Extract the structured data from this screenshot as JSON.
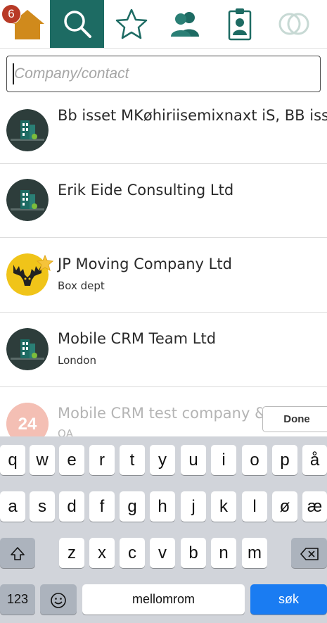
{
  "tabs": [
    {
      "name": "home-tab",
      "icon": "home-icon",
      "badge": "6"
    },
    {
      "name": "search-tab",
      "icon": "search-icon",
      "active": true
    },
    {
      "name": "favorites-tab",
      "icon": "star-icon"
    },
    {
      "name": "contacts-tab",
      "icon": "people-icon"
    },
    {
      "name": "badge-tab",
      "icon": "id-badge-icon"
    },
    {
      "name": "circles-tab",
      "icon": "circles-icon"
    }
  ],
  "search": {
    "placeholder": "Company/contact",
    "value": ""
  },
  "results": [
    {
      "name": "Bb isset MKøhiriisemixnaxt iS, BB isset",
      "sub": "",
      "avatar": "building-icon"
    },
    {
      "name": "Erik Eide Consulting Ltd",
      "sub": "",
      "avatar": "building-icon"
    },
    {
      "name": "JP Moving Company Ltd",
      "sub": "Box dept",
      "avatar": "moose-icon",
      "favorite": true
    },
    {
      "name": "Mobile CRM Team Ltd",
      "sub": "London",
      "avatar": "building-icon"
    },
    {
      "name": "Mobile CRM test company & Ltd",
      "sub": "QA",
      "avatar": "24-logo-icon"
    }
  ],
  "done_label": "Done",
  "avatar_24_text": "24",
  "keyboard": {
    "row1": [
      "q",
      "w",
      "e",
      "r",
      "t",
      "y",
      "u",
      "i",
      "o",
      "p",
      "å"
    ],
    "row2": [
      "a",
      "s",
      "d",
      "f",
      "g",
      "h",
      "j",
      "k",
      "l",
      "ø",
      "æ"
    ],
    "row3": [
      "z",
      "x",
      "c",
      "v",
      "b",
      "n",
      "m"
    ],
    "numbers": "123",
    "space": "mellomrom",
    "return": "søk"
  },
  "colors": {
    "accent": "#1d6b63",
    "home": "#d08a1c",
    "badge": "#b83a26",
    "return_key": "#1a7cf2",
    "building_dark": "#2d3d3b"
  }
}
